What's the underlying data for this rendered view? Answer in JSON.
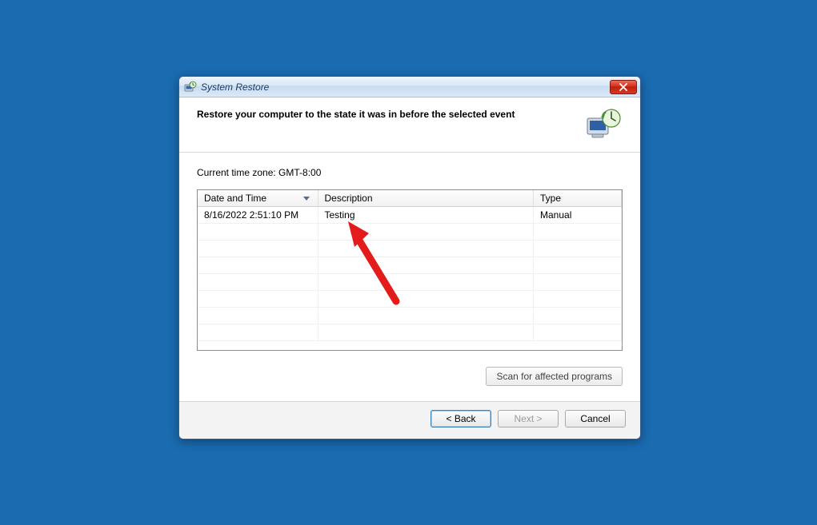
{
  "window": {
    "title": "System Restore"
  },
  "header": {
    "heading": "Restore your computer to the state it was in before the selected event"
  },
  "body": {
    "timezone_label": "Current time zone: GMT-8:00"
  },
  "grid": {
    "columns": {
      "datetime": "Date and Time",
      "description": "Description",
      "type": "Type"
    },
    "rows": [
      {
        "datetime": "8/16/2022 2:51:10 PM",
        "description": "Testing",
        "type": "Manual"
      }
    ]
  },
  "buttons": {
    "scan": "Scan for affected programs",
    "back": "< Back",
    "next": "Next >",
    "cancel": "Cancel"
  }
}
